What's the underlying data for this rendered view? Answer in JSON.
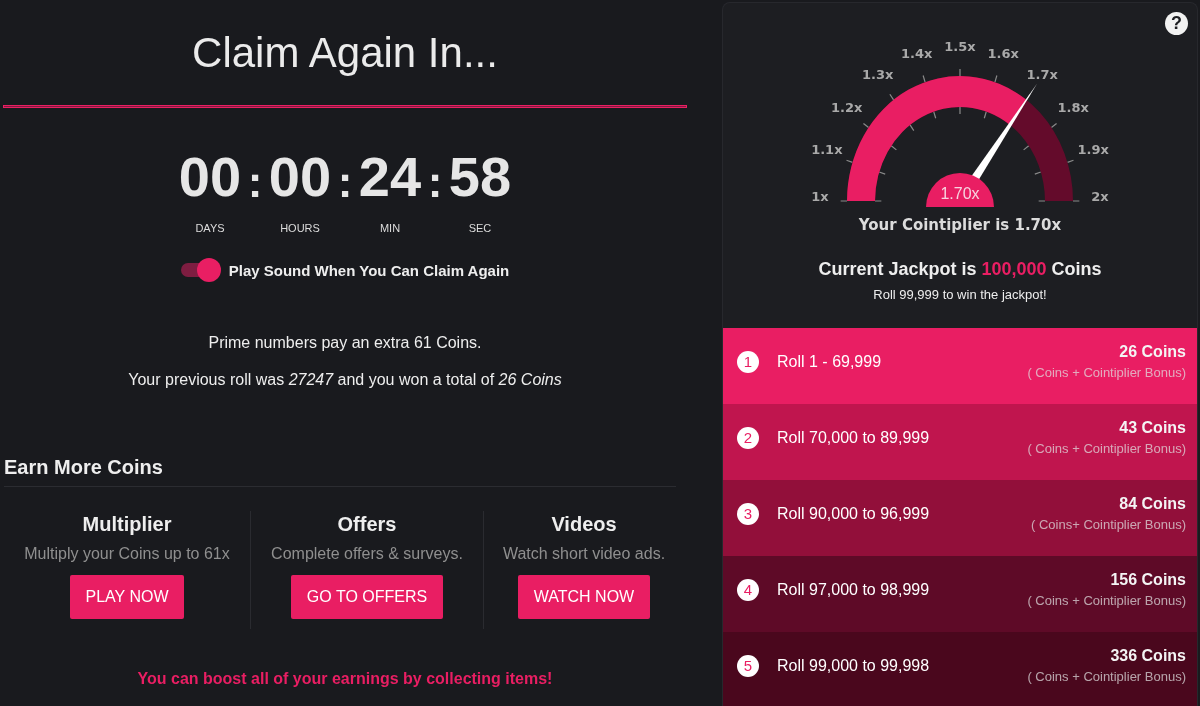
{
  "title": "Claim Again In...",
  "countdown": [
    {
      "value": "00",
      "label": "DAYS",
      "separator": ":"
    },
    {
      "value": "00",
      "label": "HOURS",
      "separator": ":"
    },
    {
      "value": "24",
      "label": "MIN",
      "separator": ":"
    },
    {
      "value": "58",
      "label": "SEC"
    }
  ],
  "sound_toggle": {
    "label": "Play Sound When You Can Claim Again",
    "on": true
  },
  "prime_note": "Prime numbers pay an extra 61 Coins.",
  "previous_roll": "Your previous roll was *27247* and you won a total of *26 Coins*",
  "earn_more": {
    "heading": "Earn More Coins",
    "options": [
      {
        "title": "Multiplier",
        "description": "Multiply your Coins up to 61x",
        "button": "PLAY NOW"
      },
      {
        "title": "Offers",
        "description": "Complete offers & surveys.",
        "button": "GO TO OFFERS"
      },
      {
        "title": "Videos",
        "description": "Watch short video ads.",
        "button": "WATCH NOW"
      }
    ]
  },
  "boost_note": "You can boost all of your earnings by collecting items!",
  "cointiplier": {
    "help_button": "?",
    "gauge": {
      "ticks": [
        "1x",
        "1.1x",
        "1.2x",
        "1.3x",
        "1.4x",
        "1.5x",
        "1.6x",
        "1.7x",
        "1.8x",
        "1.9x",
        "2x"
      ],
      "level": 0.7,
      "value": "1.70x"
    },
    "caption": "Your Cointiplier is 1.70x",
    "jackpot": {
      "prefix": "Current Jackpot is",
      "amount": "100,000",
      "suffix": "Coins"
    },
    "jackpot_hint": "Roll 99,999 to win the jackpot!"
  },
  "tiers": [
    {
      "number": "1",
      "range": "Roll 1 - 69,999",
      "reward": "26 Coins",
      "note": "( Coins + Cointiplier Bonus)",
      "color": "#e91e63"
    },
    {
      "number": "2",
      "range": "Roll 70,000 to 89,999",
      "reward": "43 Coins",
      "note": "( Coins + Cointiplier Bonus)",
      "color": "#c0154e"
    },
    {
      "number": "3",
      "range": "Roll 90,000 to 96,999",
      "reward": "84 Coins",
      "note": "( Coins+ Cointiplier Bonus)",
      "color": "#920f3a"
    },
    {
      "number": "4",
      "range": "Roll 97,000 to 98,999",
      "reward": "156 Coins",
      "note": "( Coins + Cointiplier Bonus)",
      "color": "#5e0a27"
    },
    {
      "number": "5",
      "range": "Roll 99,000 to 99,998",
      "reward": "336 Coins",
      "note": "( Coins + Cointiplier Bonus)",
      "color": "#4a071d"
    }
  ]
}
